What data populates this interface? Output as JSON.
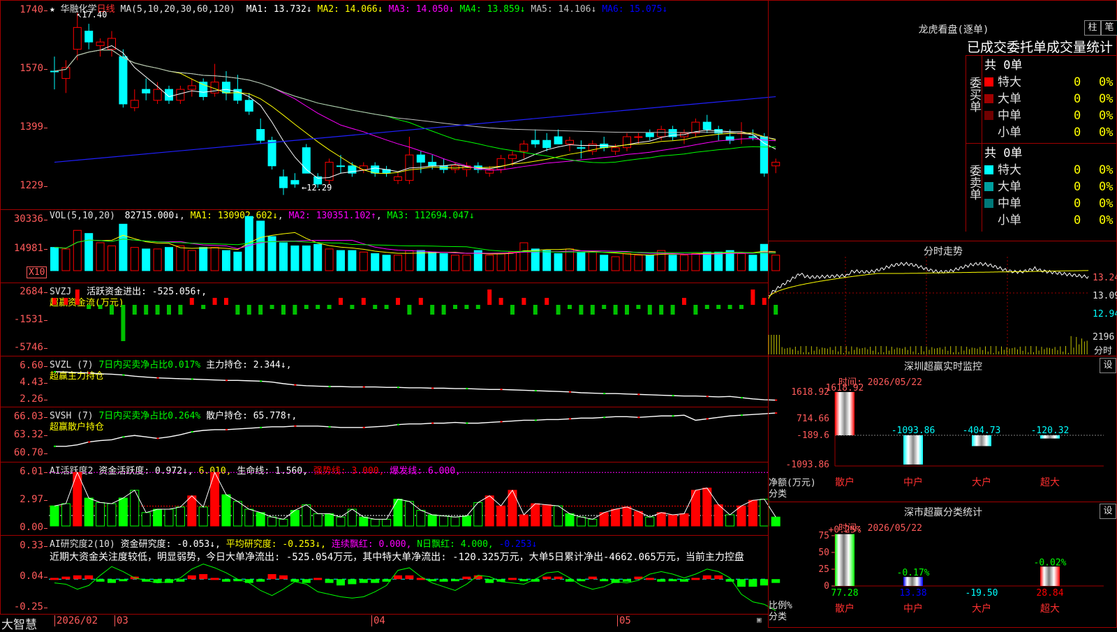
{
  "stock": {
    "name": "华融化学",
    "period": "日线",
    "ma_header": "MA(5,10,20,30,60,120)",
    "ma": [
      {
        "label": "MA1:",
        "value": "13.732",
        "arrow": "↓",
        "color": "#ffffff"
      },
      {
        "label": "MA2:",
        "value": "14.066",
        "arrow": "↓",
        "color": "#ffff00"
      },
      {
        "label": "MA3:",
        "value": "14.050",
        "arrow": "↓",
        "color": "#ff00ff"
      },
      {
        "label": "MA4:",
        "value": "13.859",
        "arrow": "↓",
        "color": "#00ff00"
      },
      {
        "label": "MA5:",
        "value": "14.106",
        "arrow": "↓",
        "color": "#c0c0c0"
      },
      {
        "label": "MA6:",
        "value": "15.075",
        "arrow": "↓",
        "color": "#0000ff"
      }
    ],
    "high_label": "17.40",
    "low_label": "12.29",
    "y_ticks": [
      "1740",
      "1570",
      "1399",
      "1229"
    ]
  },
  "colors": {
    "up": "#ff0000",
    "down": "#00ffff",
    "bg": "#000000",
    "grid": "#a00000",
    "axis_text": "#ff5a5a"
  },
  "candles": [
    [
      15.8,
      16.2,
      15.3,
      15.8,
      0
    ],
    [
      15.6,
      16.1,
      15.2,
      15.9,
      1
    ],
    [
      16.4,
      17.4,
      16.1,
      17.0,
      1
    ],
    [
      16.9,
      17.1,
      16.4,
      16.6,
      0
    ],
    [
      16.5,
      16.7,
      16.2,
      16.6,
      1
    ],
    [
      16.7,
      16.9,
      16.2,
      16.4,
      1
    ],
    [
      16.2,
      16.4,
      14.8,
      14.9,
      0
    ],
    [
      14.8,
      15.3,
      14.7,
      15.0,
      1
    ],
    [
      15.2,
      15.6,
      15.0,
      15.3,
      0
    ],
    [
      15.0,
      15.5,
      14.9,
      15.3,
      1
    ],
    [
      15.3,
      15.4,
      14.9,
      15.0,
      0
    ],
    [
      15.0,
      15.4,
      14.9,
      15.3,
      1
    ],
    [
      15.3,
      15.6,
      15.1,
      15.4,
      1
    ],
    [
      15.5,
      15.6,
      15.0,
      15.1,
      0
    ],
    [
      15.2,
      16.0,
      15.1,
      15.5,
      1
    ],
    [
      15.5,
      15.8,
      15.0,
      15.2,
      0
    ],
    [
      15.3,
      15.7,
      14.9,
      15.0,
      0
    ],
    [
      15.0,
      15.2,
      14.6,
      14.7,
      0
    ],
    [
      14.2,
      14.5,
      13.8,
      13.9,
      0
    ],
    [
      13.9,
      14.0,
      13.1,
      13.2,
      0
    ],
    [
      12.9,
      13.1,
      12.4,
      12.6,
      0
    ],
    [
      12.7,
      13.0,
      12.6,
      12.8,
      0
    ],
    [
      13.7,
      13.8,
      13.0,
      13.0,
      0
    ],
    [
      12.9,
      13.0,
      12.6,
      12.7,
      0
    ],
    [
      12.8,
      13.4,
      12.7,
      13.3,
      1
    ],
    [
      13.2,
      13.5,
      13.0,
      13.2,
      0
    ],
    [
      13.2,
      13.3,
      12.9,
      13.0,
      0
    ],
    [
      13.1,
      13.3,
      13.0,
      13.2,
      1
    ],
    [
      13.2,
      13.3,
      12.9,
      13.0,
      0
    ],
    [
      13.0,
      13.2,
      12.9,
      13.1,
      0
    ],
    [
      12.8,
      13.0,
      12.7,
      12.9,
      1
    ],
    [
      12.8,
      14.0,
      12.7,
      13.5,
      1
    ],
    [
      13.5,
      13.6,
      13.0,
      13.3,
      0
    ],
    [
      13.3,
      13.5,
      13.1,
      13.2,
      0
    ],
    [
      13.2,
      13.4,
      13.0,
      13.1,
      0
    ],
    [
      13.2,
      13.3,
      13.0,
      13.1,
      1
    ],
    [
      13.1,
      13.3,
      12.9,
      13.2,
      1
    ],
    [
      13.2,
      13.3,
      13.0,
      13.1,
      0
    ],
    [
      13.0,
      13.2,
      12.9,
      13.1,
      1
    ],
    [
      13.1,
      13.5,
      13.0,
      13.4,
      1
    ],
    [
      13.4,
      13.6,
      13.2,
      13.5,
      1
    ],
    [
      13.6,
      13.9,
      13.4,
      13.8,
      1
    ],
    [
      13.9,
      14.2,
      13.7,
      13.8,
      0
    ],
    [
      13.9,
      14.1,
      13.6,
      13.7,
      0
    ],
    [
      14.0,
      14.2,
      13.8,
      13.8,
      0
    ],
    [
      13.9,
      14.0,
      13.6,
      13.8,
      1
    ],
    [
      13.7,
      13.9,
      13.4,
      13.7,
      0
    ],
    [
      13.6,
      13.9,
      13.5,
      13.8,
      1
    ],
    [
      13.8,
      14.0,
      13.6,
      13.7,
      0
    ],
    [
      13.6,
      13.8,
      13.5,
      13.7,
      1
    ],
    [
      13.7,
      14.1,
      13.6,
      14.0,
      1
    ],
    [
      14.0,
      14.1,
      13.8,
      14.0,
      1
    ],
    [
      14.1,
      14.2,
      13.9,
      14.0,
      0
    ],
    [
      14.0,
      14.3,
      13.9,
      14.2,
      1
    ],
    [
      14.2,
      14.3,
      13.9,
      14.0,
      0
    ],
    [
      14.0,
      14.2,
      13.8,
      14.1,
      1
    ],
    [
      14.1,
      14.5,
      14.0,
      14.4,
      1
    ],
    [
      14.4,
      14.6,
      14.1,
      14.2,
      0
    ],
    [
      14.2,
      14.3,
      13.9,
      14.1,
      0
    ],
    [
      14.0,
      14.2,
      13.8,
      13.9,
      0
    ],
    [
      14.1,
      14.4,
      13.8,
      14.1,
      1
    ],
    [
      14.0,
      14.2,
      13.9,
      14.0,
      0
    ],
    [
      14.0,
      14.1,
      12.9,
      13.0,
      0
    ],
    [
      13.2,
      13.4,
      13.0,
      13.3,
      1
    ]
  ],
  "vol_panel": {
    "header": "VOL(5,10,20)",
    "val": "82715.000↓",
    "ma1": "MA1: 130902.602↓",
    "ma2": "MA2: 130351.102↑",
    "ma3": "MA3: 112694.047↓",
    "ticks": [
      "30336",
      "14981"
    ],
    "unit": "X10"
  },
  "volumes": [
    1.5,
    1.4,
    2.6,
    2.4,
    1.8,
    1.6,
    3.0,
    1.5,
    1.4,
    1.4,
    1.5,
    1.6,
    1.3,
    1.5,
    1.5,
    1.3,
    1.2,
    3.5,
    3.2,
    2.2,
    1.8,
    1.6,
    1.6,
    1.7,
    1.4,
    1.3,
    1.3,
    1.2,
    1.1,
    1.0,
    1.0,
    1.3,
    1.3,
    1.2,
    1.1,
    1.0,
    1.0,
    1.3,
    1.0,
    1.1,
    1.2,
    1.8,
    1.4,
    1.3,
    1.1,
    1.4,
    1.2,
    1.2,
    1.0,
    0.9,
    1.1,
    1.0,
    1.0,
    1.3,
    1.0,
    1.0,
    1.1,
    1.2,
    1.2,
    1.3,
    1.1,
    1.0,
    1.7,
    1.0
  ],
  "svzj": {
    "header": "SVZJ",
    "label1": "活跃资金进出: -525.056↑,",
    "label2": "超赢资金流(万元)",
    "ticks": [
      "2684",
      "-1531",
      "-5746"
    ]
  },
  "svzj_values": [
    1,
    1,
    2,
    0,
    0,
    -1,
    -1,
    -1,
    -1,
    -1,
    -1,
    -1,
    1,
    0,
    1,
    1,
    -1,
    -1,
    -1,
    0,
    -1,
    -1,
    0,
    0,
    0,
    1,
    0,
    1,
    0,
    0,
    1,
    -1,
    1,
    -1,
    -1,
    0,
    0,
    0,
    2,
    1,
    -1,
    1,
    -1,
    1,
    -1,
    0,
    -1,
    -1,
    0,
    -1,
    -1,
    0,
    -1,
    -1,
    -1,
    1,
    -1,
    0,
    0,
    0,
    0,
    2,
    1,
    -1
  ],
  "svzl": {
    "header": "SVZL (7)",
    "label1": "7日内买卖净占比0.017%",
    "label2": "主力持仓: 2.344↓,",
    "sub": "超赢主力持仓",
    "ticks": [
      "6.60",
      "4.43",
      "2.26"
    ]
  },
  "svzl_values": [
    5.85,
    5.8,
    5.75,
    5.7,
    5.6,
    5.55,
    5.45,
    5.3,
    5.2,
    5.1,
    5.05,
    5.0,
    4.95,
    4.9,
    4.85,
    4.8,
    4.8,
    4.75,
    4.7,
    4.6,
    4.4,
    4.25,
    4.15,
    4.1,
    4.05,
    4.05,
    4.0,
    4.0,
    4.0,
    3.95,
    3.95,
    3.9,
    3.9,
    3.85,
    3.85,
    3.8,
    3.8,
    3.75,
    3.7,
    3.7,
    3.65,
    3.6,
    3.55,
    3.5,
    3.45,
    3.4,
    3.3,
    3.25,
    3.2,
    3.2,
    3.15,
    3.1,
    3.05,
    3.0,
    2.95,
    2.9,
    2.9,
    2.85,
    2.8,
    2.85,
    2.7,
    2.55,
    2.45,
    2.4
  ],
  "svsh": {
    "header": "SVSH (7)",
    "label1": "7日内买卖净占比0.264%",
    "label2": "散户持仓: 65.778↑,",
    "sub": "超赢散户持仓",
    "ticks": [
      "66.03",
      "63.32",
      "60.70"
    ]
  },
  "svsh_values": [
    61.2,
    61.2,
    61.4,
    61.8,
    62.0,
    62.1,
    62.5,
    62.7,
    62.5,
    62.3,
    62.5,
    62.8,
    63.2,
    63.4,
    63.5,
    63.5,
    63.6,
    63.7,
    63.8,
    63.9,
    63.9,
    64.0,
    64.0,
    64.0,
    63.9,
    63.8,
    63.8,
    63.8,
    63.9,
    64.0,
    64.2,
    64.3,
    64.3,
    64.4,
    64.4,
    64.5,
    64.4,
    64.4,
    64.5,
    64.6,
    64.7,
    64.8,
    64.8,
    64.9,
    64.9,
    65.0,
    65.1,
    65.1,
    65.2,
    65.3,
    65.3,
    65.2,
    65.3,
    65.4,
    65.4,
    65.5,
    64.8,
    65.0,
    65.2,
    65.4,
    65.5,
    65.6,
    65.7,
    65.8
  ],
  "ai_act": {
    "header": "AI活跃度2",
    "l1": "资金活跃度: 0.972↓,",
    "l2": "6.010,",
    "l3": "生命线: 1.560,",
    "l4": "强势线: 3.000,",
    "l5": "爆发线: 6.000,",
    "ticks": [
      "6.01",
      "2.97",
      "0.00"
    ]
  },
  "ai_act_values": [
    [
      1.8,
      0
    ],
    [
      2.0,
      0
    ],
    [
      4.8,
      1
    ],
    [
      2.5,
      0
    ],
    [
      2.1,
      0
    ],
    [
      2.0,
      0
    ],
    [
      2.5,
      0
    ],
    [
      3.2,
      0
    ],
    [
      1.2,
      0
    ],
    [
      1.5,
      0
    ],
    [
      1.5,
      0
    ],
    [
      1.7,
      0
    ],
    [
      2.7,
      1
    ],
    [
      1.7,
      0
    ],
    [
      4.8,
      1
    ],
    [
      2.8,
      0
    ],
    [
      2.2,
      0
    ],
    [
      1.5,
      0
    ],
    [
      1.2,
      0
    ],
    [
      0.8,
      0
    ],
    [
      0.6,
      0
    ],
    [
      1.4,
      0
    ],
    [
      1.9,
      0
    ],
    [
      1.1,
      0
    ],
    [
      1.1,
      0
    ],
    [
      0.8,
      0
    ],
    [
      1.5,
      0
    ],
    [
      0.8,
      0
    ],
    [
      0.6,
      0
    ],
    [
      0.6,
      0
    ],
    [
      2.4,
      0
    ],
    [
      2.2,
      0
    ],
    [
      1.4,
      0
    ],
    [
      1.0,
      0
    ],
    [
      0.9,
      0
    ],
    [
      0.8,
      0
    ],
    [
      0.9,
      0
    ],
    [
      2.1,
      0
    ],
    [
      2.7,
      1
    ],
    [
      1.8,
      1
    ],
    [
      3.2,
      1
    ],
    [
      1.0,
      1
    ],
    [
      2.0,
      1
    ],
    [
      1.9,
      1
    ],
    [
      1.8,
      0
    ],
    [
      1.1,
      0
    ],
    [
      0.8,
      0
    ],
    [
      0.6,
      0
    ],
    [
      1.2,
      1
    ],
    [
      1.5,
      1
    ],
    [
      1.7,
      1
    ],
    [
      1.3,
      1
    ],
    [
      0.8,
      0
    ],
    [
      1.2,
      1
    ],
    [
      1.0,
      1
    ],
    [
      1.1,
      1
    ],
    [
      3.2,
      1
    ],
    [
      3.4,
      1
    ],
    [
      1.9,
      1
    ],
    [
      1.0,
      0
    ],
    [
      1.8,
      1
    ],
    [
      2.3,
      1
    ],
    [
      2.4,
      0
    ],
    [
      0.8,
      0
    ]
  ],
  "ai_res": {
    "header": "AI研究度2(10)",
    "l1": "资金研究度: -0.053↓,",
    "l2": "平均研究度: -0.253↓,",
    "l3": "连续飘红: 0.000,",
    "l4": "N日飘红: 4.000,",
    "l5": "-0.253↓",
    "desc": "近期大资金关注度较低，明显弱势，今日大单净流出: -525.054万元，其中特大单净流出: -120.325万元，大单5日累计净出-4662.065万元，当前主力控盘",
    "ticks": [
      "0.33",
      "0.04",
      "-0.25"
    ]
  },
  "ai_res_values": [
    0.01,
    0.02,
    0.03,
    0.03,
    -0.02,
    -0.03,
    -0.01,
    0.02,
    -0.02,
    -0.03,
    -0.03,
    -0.02,
    0.03,
    0.04,
    0.01,
    -0.02,
    -0.01,
    -0.03,
    -0.02,
    0.04,
    0.03,
    -0.02,
    -0.03,
    0.01,
    -0.03,
    -0.05,
    -0.04,
    -0.03,
    -0.03,
    -0.02,
    0.03,
    0.03,
    0.01,
    -0.01,
    -0.02,
    -0.01,
    0.02,
    0.03,
    -0.03,
    -0.02,
    0.01,
    -0.01,
    -0.02,
    0.02,
    0.02,
    -0.02,
    -0.01,
    0.02,
    -0.01,
    -0.03,
    -0.02,
    0.02,
    0.01,
    -0.02,
    -0.01,
    -0.02,
    0.01,
    0.03,
    0.03,
    -0.02,
    -0.06,
    -0.06,
    -0.05,
    -0.03
  ],
  "ai_res_line": [
    -0.03,
    -0.04,
    -0.08,
    -0.05,
    0.03,
    0.1,
    0.06,
    0.01,
    -0.01,
    -0.03,
    -0.02,
    0.01,
    0.08,
    0.12,
    0.09,
    0.05,
    0.0,
    -0.03,
    -0.09,
    -0.13,
    -0.08,
    -0.02,
    -0.04,
    -0.1,
    -0.12,
    -0.14,
    -0.15,
    -0.14,
    -0.1,
    -0.05,
    0.07,
    0.09,
    0.02,
    -0.03,
    -0.06,
    -0.09,
    -0.04,
    0.03,
    0.02,
    -0.02,
    -0.03,
    -0.04,
    0.0,
    0.05,
    0.06,
    0.01,
    -0.05,
    -0.08,
    -0.06,
    -0.02,
    -0.03,
    -0.01,
    0.04,
    0.06,
    0.04,
    0.01,
    0.04,
    0.08,
    0.06,
    0.01,
    -0.12,
    -0.18,
    -0.2,
    -0.25
  ],
  "date_axis": {
    "labels": [
      "2026/02",
      "03",
      "04",
      "05"
    ],
    "brand": "大智慧"
  },
  "dragon": {
    "title": "龙虎看盘(逐单)",
    "btn1": "柱",
    "btn2": "笔",
    "header": "已成交委托单成交量统计",
    "buy": {
      "label": "委买单",
      "total": "共 0单",
      "rows": [
        {
          "name": "特大",
          "count": "0",
          "pct": "0%",
          "color": "#ff0000"
        },
        {
          "name": "大单",
          "count": "0",
          "pct": "0%",
          "color": "#a00000"
        },
        {
          "name": "中单",
          "count": "0",
          "pct": "0%",
          "color": "#700000"
        },
        {
          "name": "小单",
          "count": "0",
          "pct": "0%",
          "color": "#000000"
        }
      ]
    },
    "sell": {
      "label": "委卖单",
      "total": "共 0单",
      "rows": [
        {
          "name": "特大",
          "count": "0",
          "pct": "0%",
          "color": "#00ffff"
        },
        {
          "name": "大单",
          "count": "0",
          "pct": "0%",
          "color": "#00a0a0"
        },
        {
          "name": "中单",
          "count": "0",
          "pct": "0%",
          "color": "#007878"
        },
        {
          "name": "小单",
          "count": "0",
          "pct": "0%",
          "color": "#000000"
        }
      ]
    }
  },
  "fenshi": {
    "title": "分时走势",
    "ticks": [
      "13.24",
      "13.09",
      "12.94"
    ],
    "vol": "2196",
    "vol_unit": "分时"
  },
  "monitor": {
    "title": "深圳超赢实时监控",
    "btn": "设",
    "time": "时间: 2026/05/22",
    "ylabel": "净额(万元)",
    "xlabel": "分类",
    "ticks": [
      "1618.92",
      "714.66",
      "-189.6",
      "-1093.86"
    ],
    "bars": [
      {
        "name": "散户",
        "value": 1618.92,
        "label": "1618.92"
      },
      {
        "name": "中户",
        "value": -1093.86,
        "label": "-1093.86"
      },
      {
        "name": "大户",
        "value": -404.73,
        "label": "-404.73"
      },
      {
        "name": "超大",
        "value": -120.32,
        "label": "-120.32"
      }
    ]
  },
  "classify": {
    "title": "深市超赢分类统计",
    "btn": "设",
    "time": "时间: 2026/05/22",
    "ylabel": "比例%",
    "xlabel": "分类",
    "ticks": [
      "75",
      "50",
      "25",
      "0"
    ],
    "bars": [
      {
        "name": "散户",
        "pct": 77.28,
        "top": "+0.25%",
        "bottom": "77.28",
        "bottom_color": "#00ff00"
      },
      {
        "name": "中户",
        "pct": 13.38,
        "top": "-0.17%",
        "bottom": "13.38",
        "bottom_color": "#0000ff"
      },
      {
        "name": "大户",
        "pct": 0,
        "top": "",
        "bottom": "-19.50",
        "bottom_color": "#00ffff"
      },
      {
        "name": "超大",
        "pct": 28.84,
        "top": "-0.02%",
        "bottom": "28.84",
        "bottom_color": "#ff0000"
      }
    ]
  }
}
